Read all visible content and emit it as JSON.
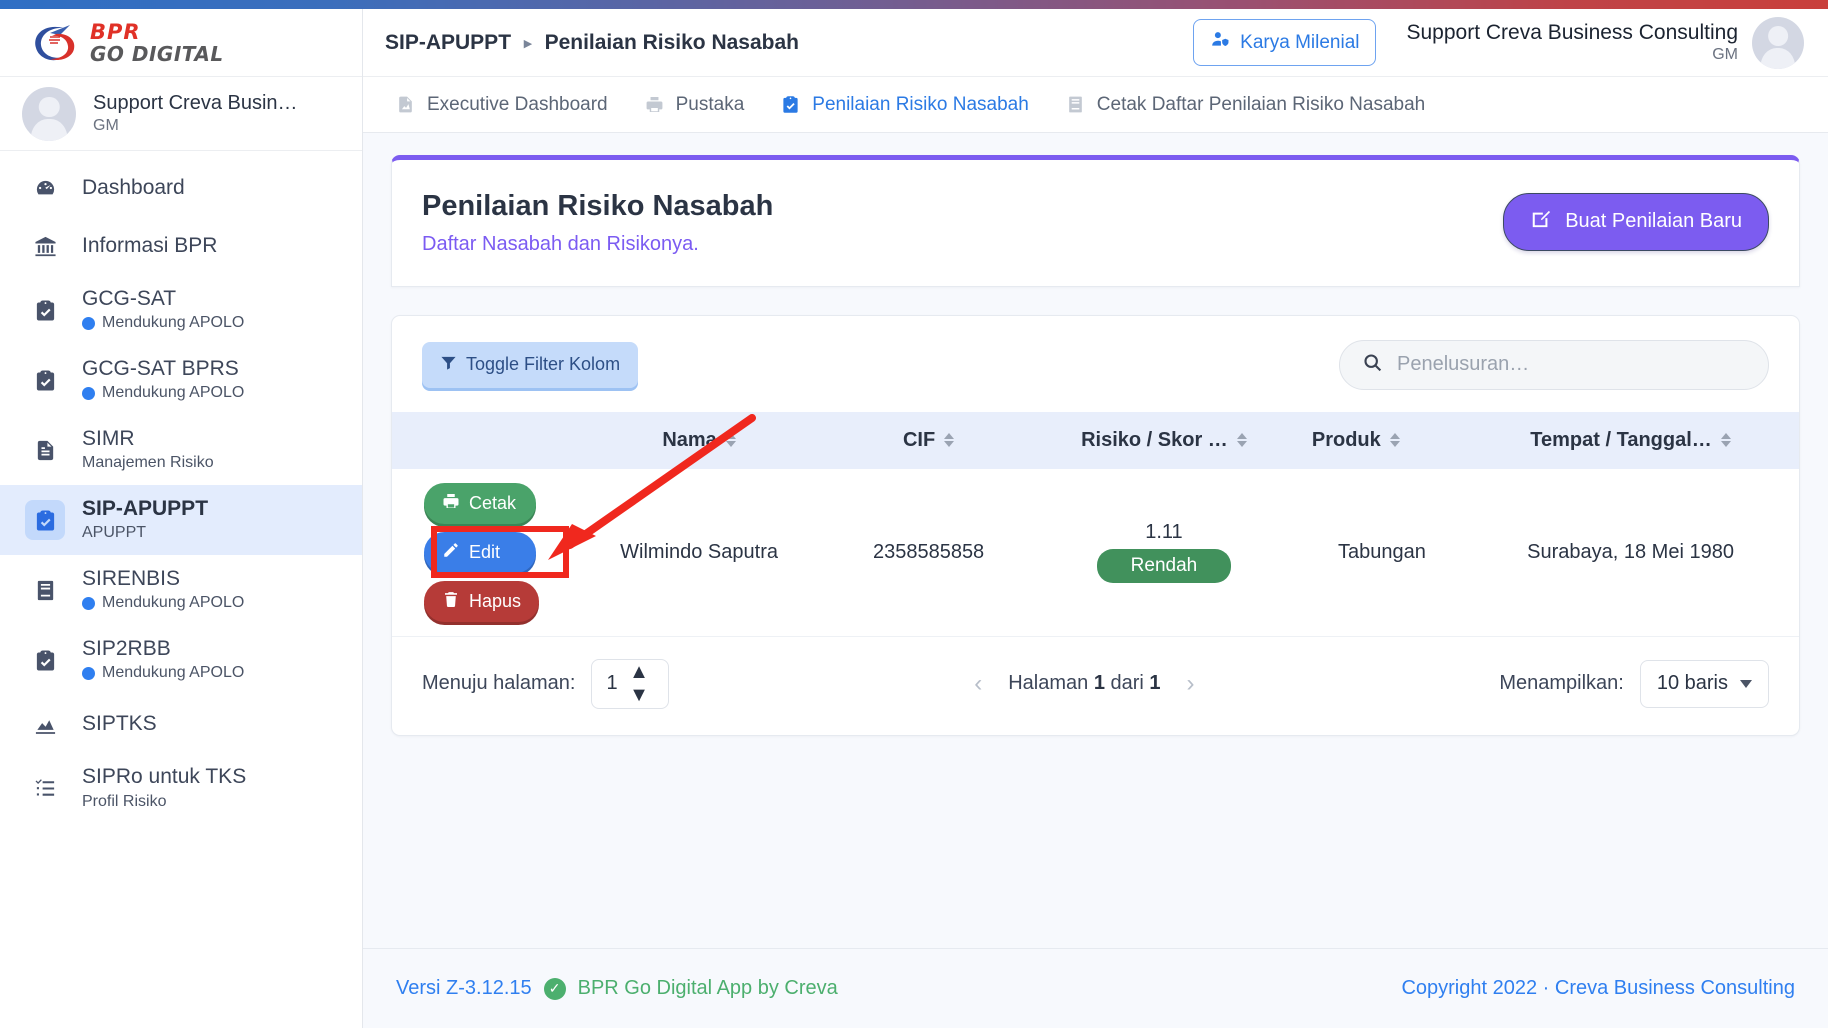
{
  "brand": {
    "line1": "BPR",
    "line2": "GO DIGITAL"
  },
  "sidebar": {
    "user": {
      "name": "Support Creva Busin…",
      "role": "GM"
    },
    "items": [
      {
        "label": "Dashboard",
        "sub": "",
        "icon": "speedometer-icon",
        "badge": false,
        "active": false
      },
      {
        "label": "Informasi BPR",
        "sub": "",
        "icon": "bank-icon",
        "badge": false,
        "active": false
      },
      {
        "label": "GCG-SAT",
        "sub": "Mendukung APOLO",
        "icon": "clipboard-check-icon",
        "badge": true,
        "active": false
      },
      {
        "label": "GCG-SAT BPRS",
        "sub": "Mendukung APOLO",
        "icon": "clipboard-check-icon",
        "badge": true,
        "active": false
      },
      {
        "label": "SIMR",
        "sub": "Manajemen Risiko",
        "icon": "document-icon",
        "badge": false,
        "active": false
      },
      {
        "label": "SIP-APUPPT",
        "sub": "APUPPT",
        "icon": "clipboard-check-icon",
        "badge": false,
        "active": true
      },
      {
        "label": "SIRENBIS",
        "sub": "Mendukung APOLO",
        "icon": "book-icon",
        "badge": true,
        "active": false
      },
      {
        "label": "SIP2RBB",
        "sub": "Mendukung APOLO",
        "icon": "clipboard-check-icon",
        "badge": true,
        "active": false
      },
      {
        "label": "SIPTKS",
        "sub": "",
        "icon": "chart-area-icon",
        "badge": false,
        "active": false
      },
      {
        "label": "SIPRo untuk TKS",
        "sub": "Profil Risiko",
        "icon": "checklist-icon",
        "badge": false,
        "active": false
      }
    ]
  },
  "topbar": {
    "breadcrumb_root": "SIP-APUPPT",
    "breadcrumb_current": "Penilaian Risiko Nasabah",
    "karya_button": "Karya Milenial",
    "user_name": "Support Creva Business Consulting",
    "user_role": "GM"
  },
  "tabs": [
    {
      "label": "Executive Dashboard",
      "icon": "report-icon",
      "active": false
    },
    {
      "label": "Pustaka",
      "icon": "printer-icon",
      "active": false
    },
    {
      "label": "Penilaian Risiko Nasabah",
      "icon": "clipboard-check-icon",
      "active": true
    },
    {
      "label": "Cetak Daftar Penilaian Risiko Nasabah",
      "icon": "book-icon",
      "active": false
    }
  ],
  "header_card": {
    "title": "Penilaian Risiko Nasabah",
    "subtitle": "Daftar Nasabah dan Risikonya.",
    "primary_button": "Buat Penilaian Baru",
    "accent_color": "#7c5cf0"
  },
  "table_toolbar": {
    "toggle_filter": "Toggle Filter Kolom",
    "search_placeholder": "Penelusuran…",
    "search_value": ""
  },
  "table": {
    "columns": [
      "",
      "Nama",
      "CIF",
      "Risiko / Skor …",
      "Produk",
      "Tempat / Tanggal…"
    ],
    "rows": [
      {
        "actions": [
          {
            "label": "Cetak",
            "icon": "printer-icon",
            "style": "cetak"
          },
          {
            "label": "Edit",
            "icon": "pencil-icon",
            "style": "edit"
          },
          {
            "label": "Hapus",
            "icon": "trash-icon",
            "style": "hapus"
          }
        ],
        "nama": "Wilmindo Saputra",
        "cif": "2358585858",
        "skor": "1.11",
        "risiko_badge": "Rendah",
        "risiko_badge_color": "#41915c",
        "produk": "Tabungan",
        "tempat_tanggal": "Surabaya, 18 Mei 1980"
      }
    ]
  },
  "pagination": {
    "goto_label": "Menuju halaman:",
    "goto_value": "1",
    "page_info_prefix": "Halaman",
    "page_current": "1",
    "page_mid": "dari",
    "page_total": "1",
    "show_label": "Menampilkan:",
    "rows_value": "10 baris"
  },
  "footer": {
    "version": "Versi Z-3.12.15",
    "app": "BPR Go Digital App by Creva",
    "copyright": "Copyright 2022 · Creva Business Consulting"
  },
  "annotation": {
    "highlight_target": "cetak-button",
    "color": "#f0281e"
  }
}
